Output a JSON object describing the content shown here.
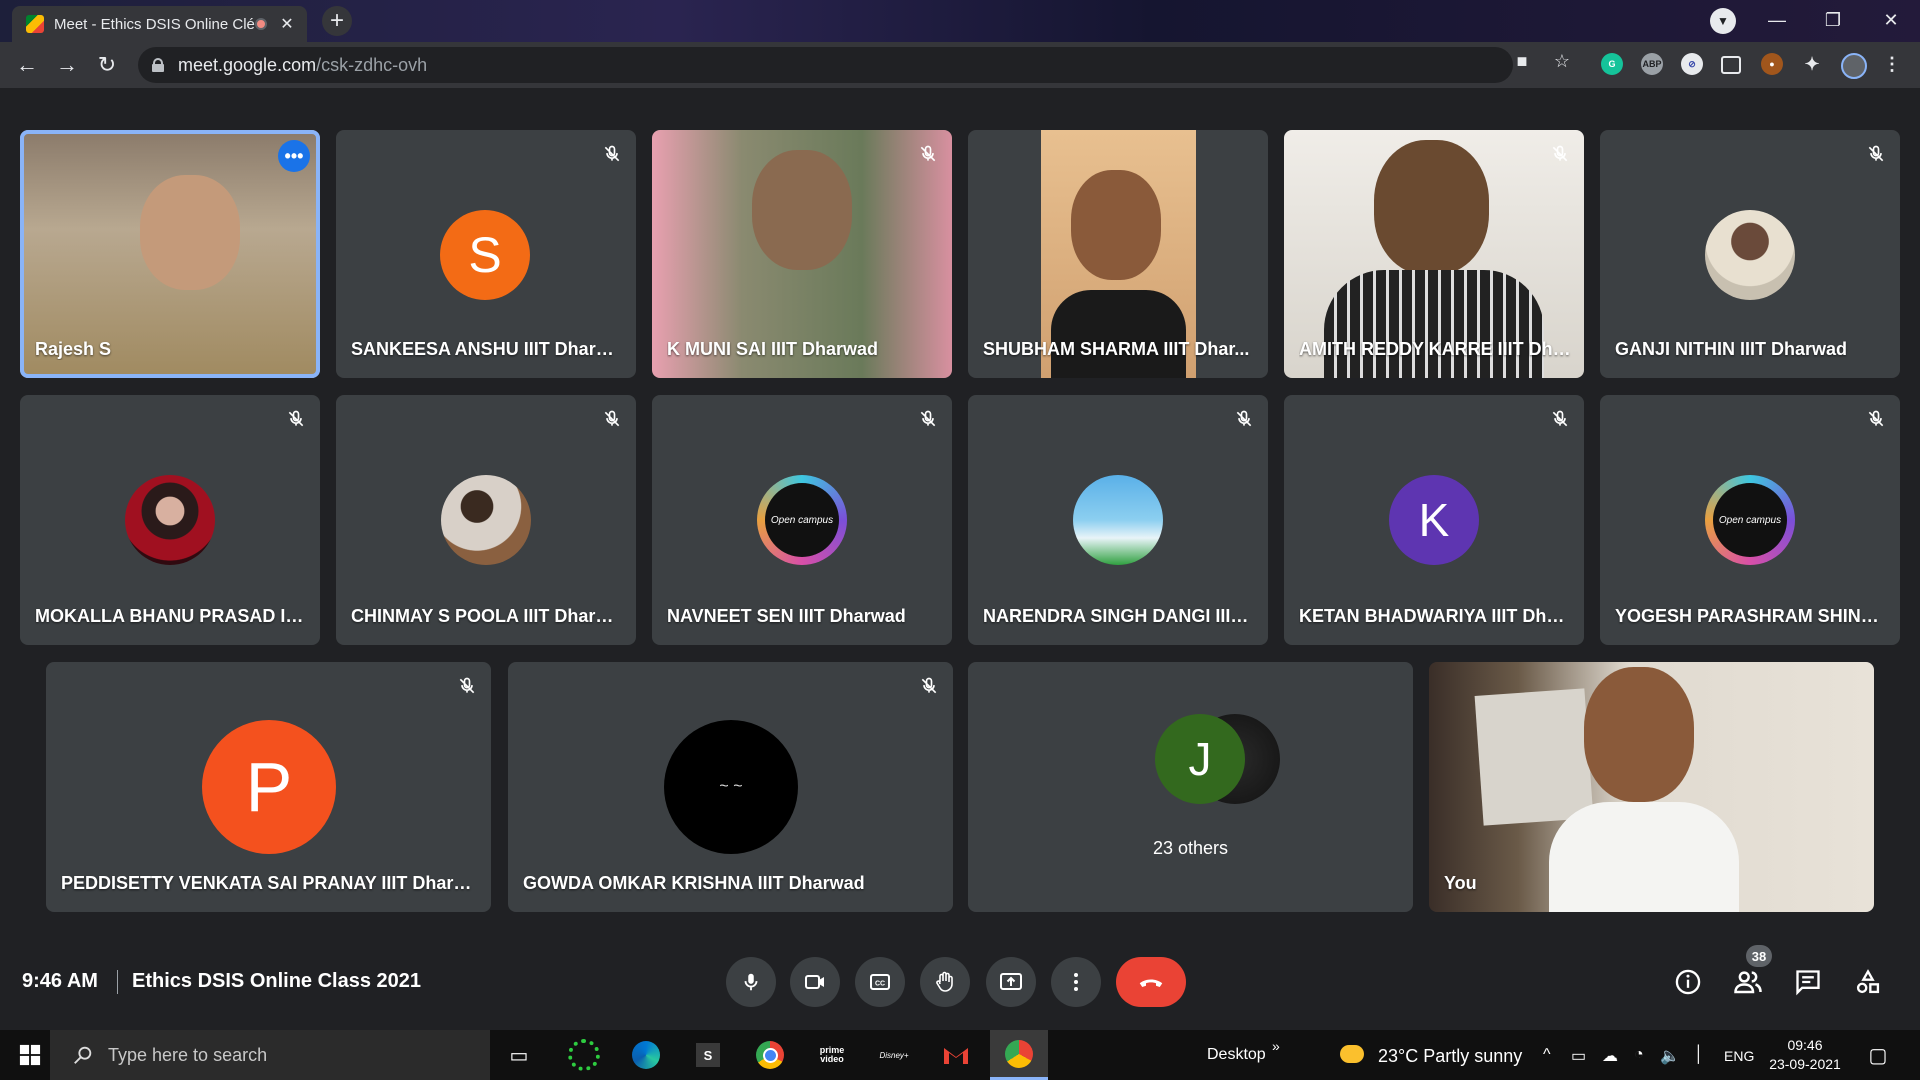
{
  "browser": {
    "tab_title": "Meet - Ethics DSIS Online Clé",
    "url_host": "meet.google.com",
    "url_path": "/csk-zdhc-ovh"
  },
  "meeting": {
    "time": "9:46 AM",
    "title": "Ethics DSIS Online Class 2021",
    "participants_count": "38"
  },
  "participants": [
    {
      "name": "Rajesh S",
      "muted": false,
      "kind": "video",
      "active": true
    },
    {
      "name": "SANKEESA ANSHU IIIT Dharwad",
      "muted": true,
      "kind": "letter",
      "letter": "S",
      "color": "#f36b15"
    },
    {
      "name": "K MUNI SAI IIIT Dharwad",
      "muted": true,
      "kind": "video"
    },
    {
      "name": "SHUBHAM SHARMA IIIT Dhar...",
      "muted": false,
      "kind": "video"
    },
    {
      "name": "AMITH REDDY KARRE IIIT Dha...",
      "muted": true,
      "kind": "video"
    },
    {
      "name": "GANJI NITHIN IIIT Dharwad",
      "muted": true,
      "kind": "photo"
    },
    {
      "name": "MOKALLA BHANU PRASAD IIIT...",
      "muted": true,
      "kind": "photo"
    },
    {
      "name": "CHINMAY S POOLA IIIT Dharwad",
      "muted": true,
      "kind": "photo"
    },
    {
      "name": "NAVNEET SEN IIIT Dharwad",
      "muted": true,
      "kind": "logo",
      "logo_text": "Open campus"
    },
    {
      "name": "NARENDRA SINGH DANGI IIIT ...",
      "muted": true,
      "kind": "photo"
    },
    {
      "name": "KETAN BHADWARIYA IIIT Dhar...",
      "muted": true,
      "kind": "letter",
      "letter": "K",
      "color": "#5e35b1"
    },
    {
      "name": "YOGESH PARASHRAM SHINDE ...",
      "muted": true,
      "kind": "logo",
      "logo_text": "Open campus"
    },
    {
      "name": "PEDDISETTY VENKATA SAI PRANAY IIIT Dharwad",
      "muted": true,
      "kind": "letter",
      "letter": "P",
      "color": "#f4511e"
    },
    {
      "name": "GOWDA OMKAR KRISHNA IIIT Dharwad",
      "muted": true,
      "kind": "photo",
      "face_text": "~ ~"
    },
    {
      "name": "You",
      "muted": false,
      "kind": "video"
    }
  ],
  "others_tile": {
    "label": "23 others",
    "letter": "J",
    "color": "#33691e"
  },
  "taskbar": {
    "search_placeholder": "Type here to search",
    "desktop_label": "Desktop",
    "weather": "23°C  Partly sunny",
    "lang": "ENG",
    "clock_time": "09:46",
    "clock_date": "23-09-2021",
    "apps": [
      "task-view",
      "green-ring-app",
      "edge",
      "s-app",
      "chrome",
      "prime-video",
      "disney-hotstar",
      "gmail",
      "chrome-active"
    ]
  },
  "colors": {
    "accent": "#8ab4f8",
    "hangup": "#ea4335",
    "surface": "#3c4043",
    "background": "#202124"
  }
}
